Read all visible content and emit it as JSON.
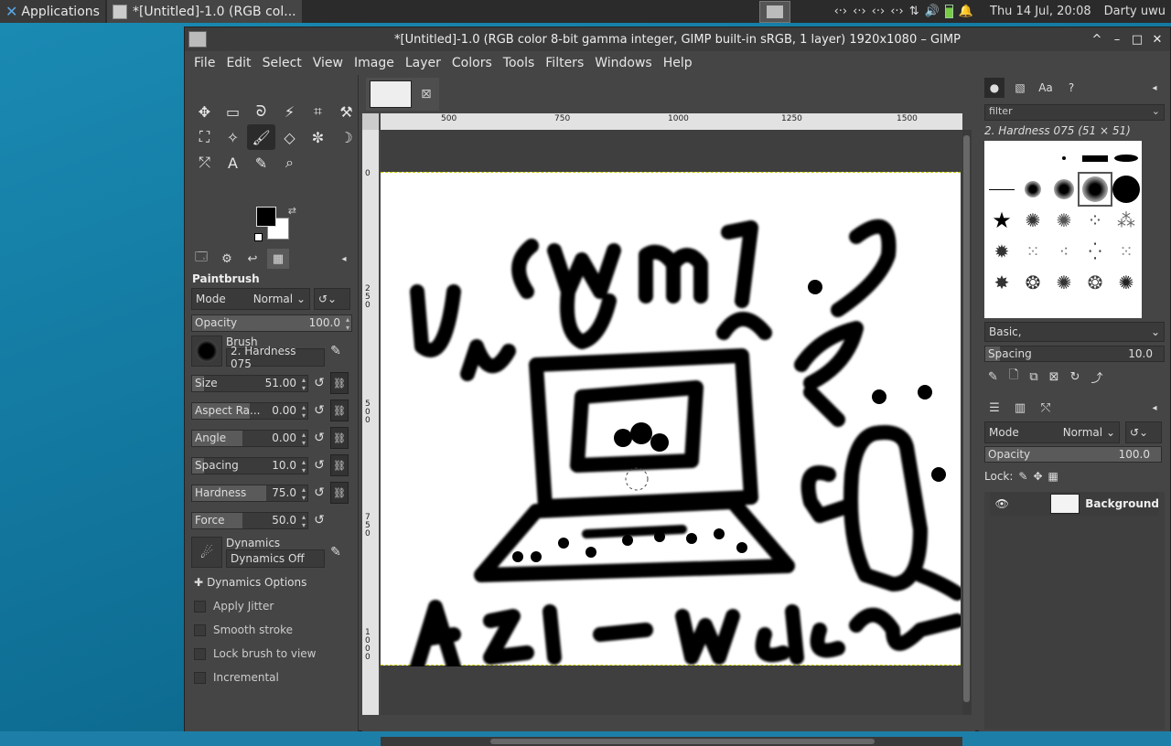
{
  "taskbar": {
    "apps_label": "Applications",
    "task_label": "*[Untitled]-1.0 (RGB col...",
    "clock": "Thu 14 Jul, 20:08",
    "user": "Darty uwu",
    "tray_icons": [
      "network-icon",
      "network-icon",
      "network-icon",
      "network-icon",
      "transfer-icon",
      "volume-icon",
      "battery-icon",
      "bell-icon"
    ]
  },
  "window": {
    "title": "*[Untitled]-1.0 (RGB color 8-bit gamma integer, GIMP built-in sRGB, 1 layer) 1920x1080 – GIMP",
    "controls": [
      "^",
      "–",
      "□",
      "✕"
    ]
  },
  "menu": [
    "File",
    "Edit",
    "Select",
    "View",
    "Image",
    "Layer",
    "Colors",
    "Tools",
    "Filters",
    "Windows",
    "Help"
  ],
  "toolbox": {
    "tools": [
      "✥",
      "▭",
      "ᘐ",
      "⚡",
      "⌗",
      "⚒",
      "⛶",
      "✧",
      "🖌",
      "◇",
      "✼",
      "☽",
      "⤱",
      "A",
      "✎",
      "⌕"
    ],
    "active_tool_index": 8,
    "tool_options_title": "Paintbrush",
    "mode_label": "Mode",
    "mode_value": "Normal",
    "opacity": {
      "label": "Opacity",
      "value": "100.0"
    },
    "brush_label": "Brush",
    "brush_name": "2. Hardness 075",
    "size": {
      "label": "Size",
      "value": "51.00"
    },
    "aspect": {
      "label": "Aspect Ra...",
      "value": "0.00"
    },
    "angle": {
      "label": "Angle",
      "value": "0.00"
    },
    "spacing": {
      "label": "Spacing",
      "value": "10.0"
    },
    "hardness": {
      "label": "Hardness",
      "value": "75.0"
    },
    "force": {
      "label": "Force",
      "value": "50.0"
    },
    "dynamics_label": "Dynamics",
    "dynamics_value": "Dynamics Off",
    "dynamics_options": "Dynamics Options",
    "apply_jitter": "Apply Jitter",
    "smooth_stroke": "Smooth stroke",
    "lock_brush": "Lock brush to view",
    "incremental": "Incremental"
  },
  "canvas": {
    "ruler_h": [
      "500",
      "750",
      "1000",
      "1250",
      "1500"
    ],
    "ruler_v": [
      "0",
      "2 5 0",
      "5 0 0",
      "7 5 0",
      "1 0 0 0"
    ]
  },
  "brushes": {
    "filter_placeholder": "filter",
    "selected_name": "2. Hardness 075 (51 × 51)",
    "tag_value": "Basic,",
    "spacing_label": "Spacing",
    "spacing_value": "10.0"
  },
  "layers": {
    "mode_label": "Mode",
    "mode_value": "Normal",
    "opacity_label": "Opacity",
    "opacity_value": "100.0",
    "lock_label": "Lock:",
    "layer_name": "Background"
  }
}
